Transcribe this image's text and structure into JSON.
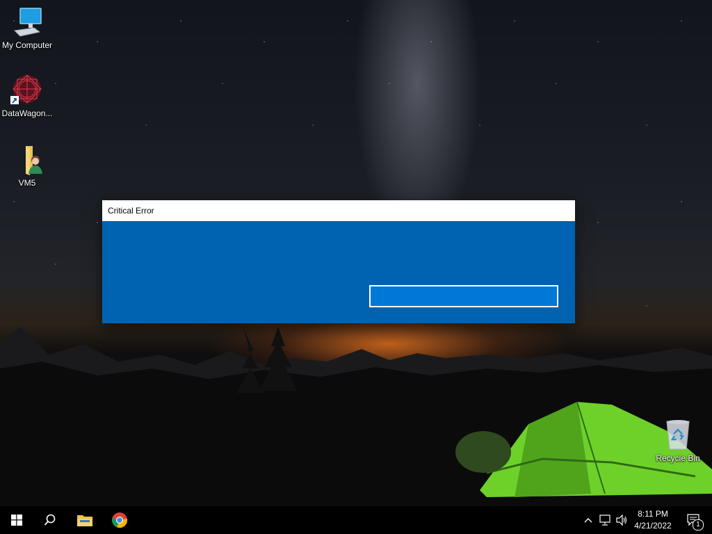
{
  "desktop": {
    "icons": [
      {
        "label": "My Computer",
        "icon": "monitor-icon"
      },
      {
        "label": "DataWagon...",
        "icon": "datawagon-app-icon"
      },
      {
        "label": "VM5",
        "icon": "user-folder-icon"
      },
      {
        "label": "Recycle Bin",
        "icon": "recycle-bin-icon"
      }
    ]
  },
  "dialog": {
    "title": "Critical Error",
    "button_label": "",
    "colors": {
      "body": "#0063b1",
      "button": "#0078d7",
      "titlebar": "#ffffff"
    }
  },
  "taskbar": {
    "start": "windows-start-icon",
    "search": "search-icon",
    "apps": [
      {
        "name": "file-explorer-icon"
      },
      {
        "name": "chrome-icon"
      }
    ],
    "tray": {
      "chevron": "chevron-up-icon",
      "network": "network-icon",
      "volume": "volume-icon",
      "time": "8:11 PM",
      "date": "4/21/2022",
      "notifications_count": "1"
    }
  }
}
